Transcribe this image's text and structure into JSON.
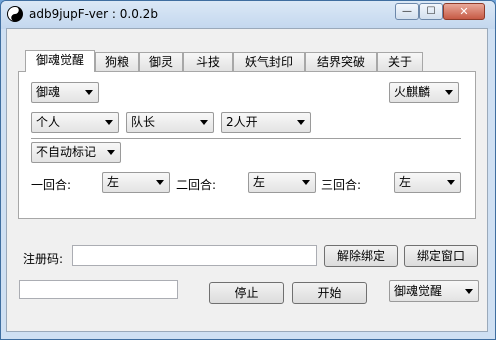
{
  "window": {
    "title": "adb9jupF-ver : 0.0.2b",
    "minimize_glyph": "—",
    "maximize_glyph": "☐",
    "close_glyph": "✕"
  },
  "tabs": [
    {
      "label": "御魂觉醒",
      "active": true
    },
    {
      "label": "狗粮",
      "active": false
    },
    {
      "label": "御灵",
      "active": false
    },
    {
      "label": "斗技",
      "active": false
    },
    {
      "label": "妖气封印",
      "active": false
    },
    {
      "label": "结界突破",
      "active": false
    },
    {
      "label": "关于",
      "active": false
    }
  ],
  "panel": {
    "mode_select": "御魂",
    "target_select": "火麒麟",
    "party_select": "个人",
    "role_select": "队长",
    "players_select": "2人开",
    "mark_select": "不自动标记",
    "rounds": [
      {
        "label": "一回合:",
        "value": "左"
      },
      {
        "label": "二回合:",
        "value": "左"
      },
      {
        "label": "三回合:",
        "value": "左"
      }
    ]
  },
  "registration": {
    "label": "注册码:",
    "code_value": "",
    "unbind_label": "解除绑定",
    "bind_window_label": "绑定窗口"
  },
  "bottom": {
    "status_value": "",
    "stop_label": "停止",
    "start_label": "开始",
    "task_select": "御魂觉醒"
  }
}
